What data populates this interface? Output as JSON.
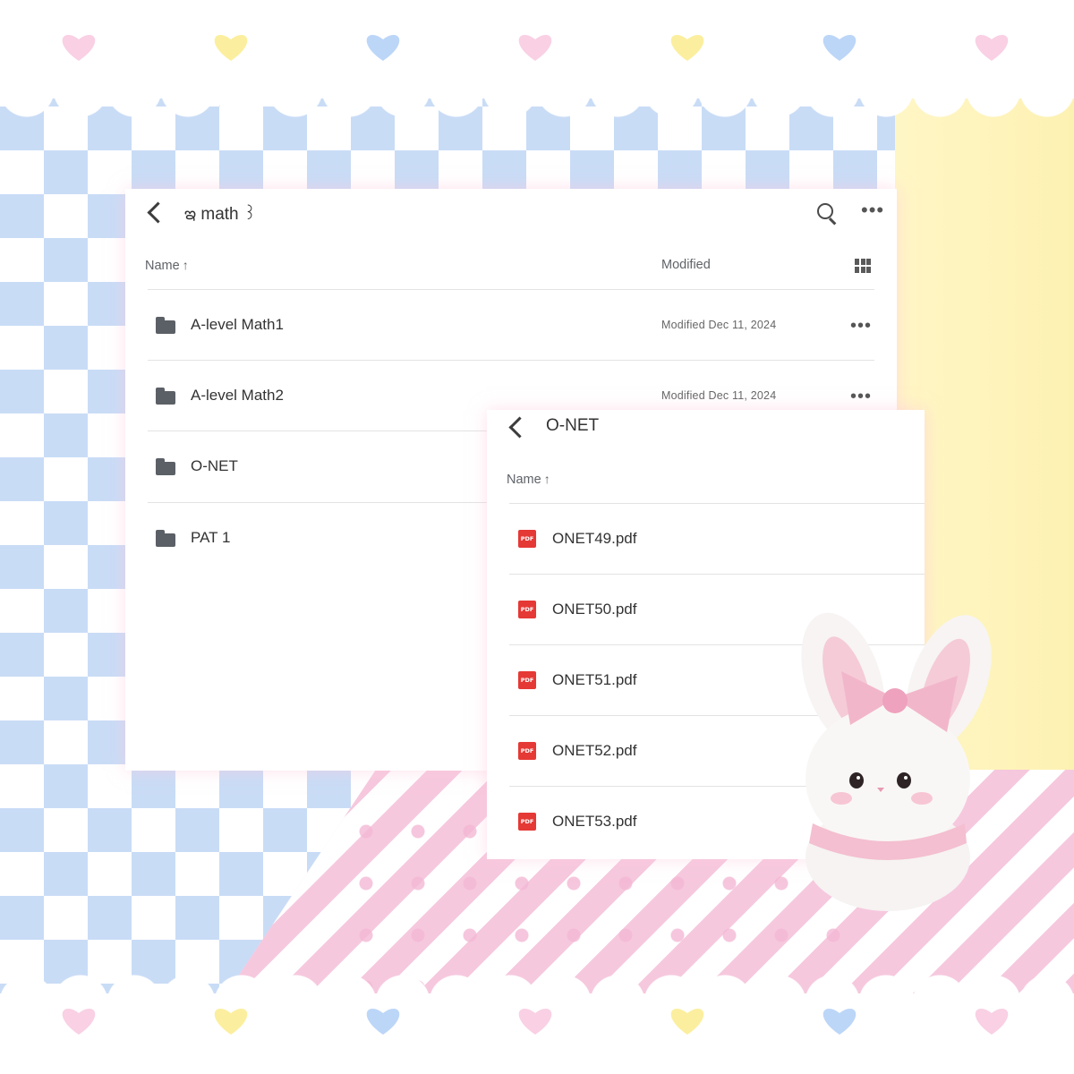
{
  "main_panel": {
    "title": "ఇ math ꒱",
    "columns": {
      "name": "Name",
      "sort_arrow": "↑",
      "modified": "Modified"
    },
    "items": [
      {
        "name": "A-level Math1",
        "modified": "Modified Dec 11, 2024"
      },
      {
        "name": "A-level Math2",
        "modified": "Modified Dec 11, 2024"
      },
      {
        "name": "O-NET",
        "modified": ""
      },
      {
        "name": "PAT 1",
        "modified": ""
      }
    ],
    "more_glyph": "•••"
  },
  "onet_panel": {
    "title": "O-NET",
    "columns": {
      "name": "Name",
      "sort_arrow": "↑"
    },
    "pdf_badge": "PDF",
    "files": [
      {
        "name": "ONET49.pdf"
      },
      {
        "name": "ONET50.pdf"
      },
      {
        "name": "ONET51.pdf"
      },
      {
        "name": "ONET52.pdf"
      },
      {
        "name": "ONET53.pdf"
      }
    ]
  },
  "colors": {
    "folder": "#5b5f66",
    "pdf": "#e53935",
    "checker_blue": "#c9dcf6",
    "pastel_yellow": "#fdf3b8",
    "pastel_pink": "#f6c8de",
    "heart_pink": "#f9d0e4",
    "heart_yellow": "#fbef9f",
    "heart_blue": "#bcd6f8"
  }
}
